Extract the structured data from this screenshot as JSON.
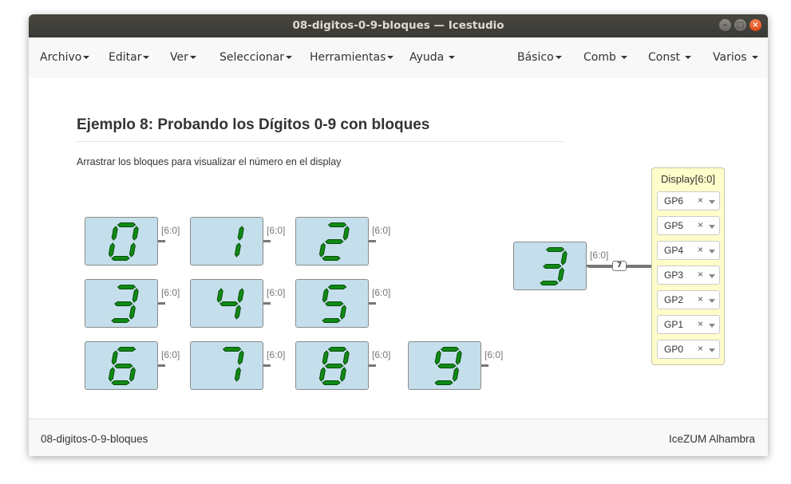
{
  "window": {
    "title": "08-digitos-0-9-bloques — Icestudio"
  },
  "menu_left": [
    {
      "label": "Archivo"
    },
    {
      "label": "Editar"
    },
    {
      "label": "Ver"
    },
    {
      "label": "Seleccionar"
    },
    {
      "label": "Herramientas"
    },
    {
      "label": "Ayuda"
    }
  ],
  "menu_right": [
    {
      "label": "Básico"
    },
    {
      "label": "Comb"
    },
    {
      "label": "Const"
    },
    {
      "label": "Varios"
    }
  ],
  "content": {
    "heading": "Ejemplo 8: Probando los Dígitos 0-9 con bloques",
    "description": "Arrastrar los bloques para visualizar el número en el display"
  },
  "digit_blocks": [
    {
      "digit": "0",
      "port_label": "[6:0]"
    },
    {
      "digit": "1",
      "port_label": "[6:0]"
    },
    {
      "digit": "2",
      "port_label": "[6:0]"
    },
    {
      "digit": "3",
      "port_label": "[6:0]"
    },
    {
      "digit": "4",
      "port_label": "[6:0]"
    },
    {
      "digit": "5",
      "port_label": "[6:0]"
    },
    {
      "digit": "6",
      "port_label": "[6:0]"
    },
    {
      "digit": "7",
      "port_label": "[6:0]"
    },
    {
      "digit": "8",
      "port_label": "[6:0]"
    },
    {
      "digit": "9",
      "port_label": "[6:0]"
    },
    {
      "digit": "3",
      "port_label": "[6:0]"
    }
  ],
  "bus_width": "7",
  "output_block": {
    "title": "Display[6:0]",
    "pins": [
      "GP6",
      "GP5",
      "GP4",
      "GP3",
      "GP2",
      "GP1",
      "GP0"
    ],
    "clear_symbol": "×"
  },
  "footer": {
    "filename": "08-digitos-0-9-bloques",
    "board": "IceZUM Alhambra"
  },
  "colors": {
    "segment_fill": "#0f8a14",
    "segment_stroke": "#0a4d0c",
    "block_bg": "#c4dfeb",
    "output_bg": "#fffdca",
    "close_button": "#df4b16"
  }
}
